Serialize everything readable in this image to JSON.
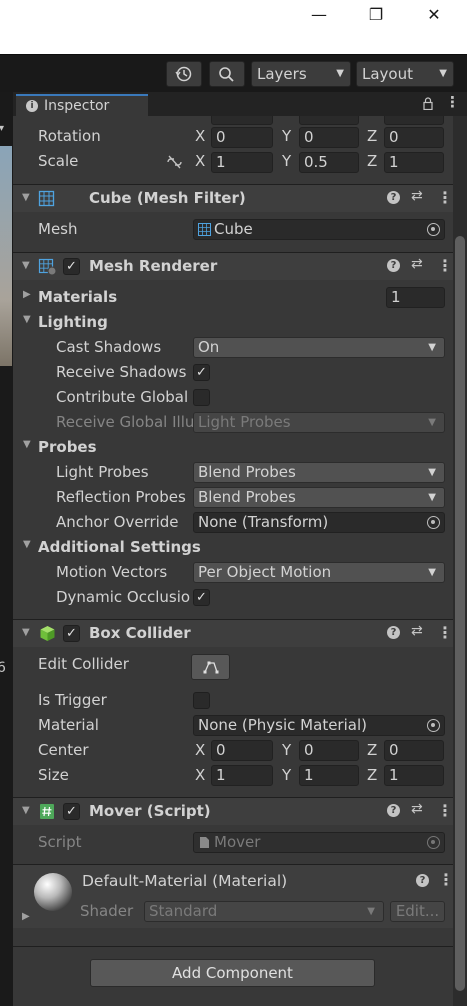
{
  "window": {
    "minimize_glyph": "—",
    "restore_glyph": "❐",
    "close_glyph": "✕"
  },
  "toolbar": {
    "history_icon": "history-icon",
    "search_icon": "search-icon",
    "layers_label": "Layers",
    "layout_label": "Layout"
  },
  "inspector": {
    "tab_label": "Inspector",
    "transform": {
      "rotation_label": "Rotation",
      "scale_label": "Scale",
      "rotation": {
        "x": "0",
        "y": "0",
        "z": "0"
      },
      "scale": {
        "x": "1",
        "y": "0.5",
        "z": "1"
      }
    },
    "mesh_filter": {
      "title": "Cube (Mesh Filter)",
      "mesh_label": "Mesh",
      "mesh_value": "Cube"
    },
    "mesh_renderer": {
      "title": "Mesh Renderer",
      "enabled": true,
      "materials_label": "Materials",
      "materials_count": "1",
      "lighting_label": "Lighting",
      "cast_shadows_label": "Cast Shadows",
      "cast_shadows_value": "On",
      "receive_shadows_label": "Receive Shadows",
      "receive_shadows": true,
      "contribute_gi_label": "Contribute Global I",
      "contribute_gi": false,
      "receive_gi_label": "Receive Global Illu",
      "receive_gi_value": "Light Probes",
      "probes_label": "Probes",
      "light_probes_label": "Light Probes",
      "light_probes_value": "Blend Probes",
      "reflection_probes_label": "Reflection Probes",
      "reflection_probes_value": "Blend Probes",
      "anchor_override_label": "Anchor Override",
      "anchor_override_value": "None (Transform)",
      "additional_settings_label": "Additional Settings",
      "motion_vectors_label": "Motion Vectors",
      "motion_vectors_value": "Per Object Motion",
      "dynamic_occlusion_label": "Dynamic Occlusio",
      "dynamic_occlusion": true
    },
    "box_collider": {
      "title": "Box Collider",
      "enabled": true,
      "edit_collider_label": "Edit Collider",
      "is_trigger_label": "Is Trigger",
      "is_trigger": false,
      "material_label": "Material",
      "material_value": "None (Physic Material)",
      "center_label": "Center",
      "center": {
        "x": "0",
        "y": "0",
        "z": "0"
      },
      "size_label": "Size",
      "size": {
        "x": "1",
        "y": "1",
        "z": "1"
      }
    },
    "mover_script": {
      "title": "Mover (Script)",
      "enabled": true,
      "script_label": "Script",
      "script_value": "Mover"
    },
    "material": {
      "title": "Default-Material (Material)",
      "shader_label": "Shader",
      "shader_value": "Standard",
      "edit_label": "Edit..."
    },
    "add_component_label": "Add Component",
    "axis_labels": {
      "x": "X",
      "y": "Y",
      "z": "Z"
    },
    "check_glyph": "✓",
    "help_glyph": "?"
  },
  "colors": {
    "panel_bg": "#383838",
    "header_bg": "#3e3e3e",
    "tab_accent": "#3a79bb",
    "toolbar_bg": "#191919"
  }
}
